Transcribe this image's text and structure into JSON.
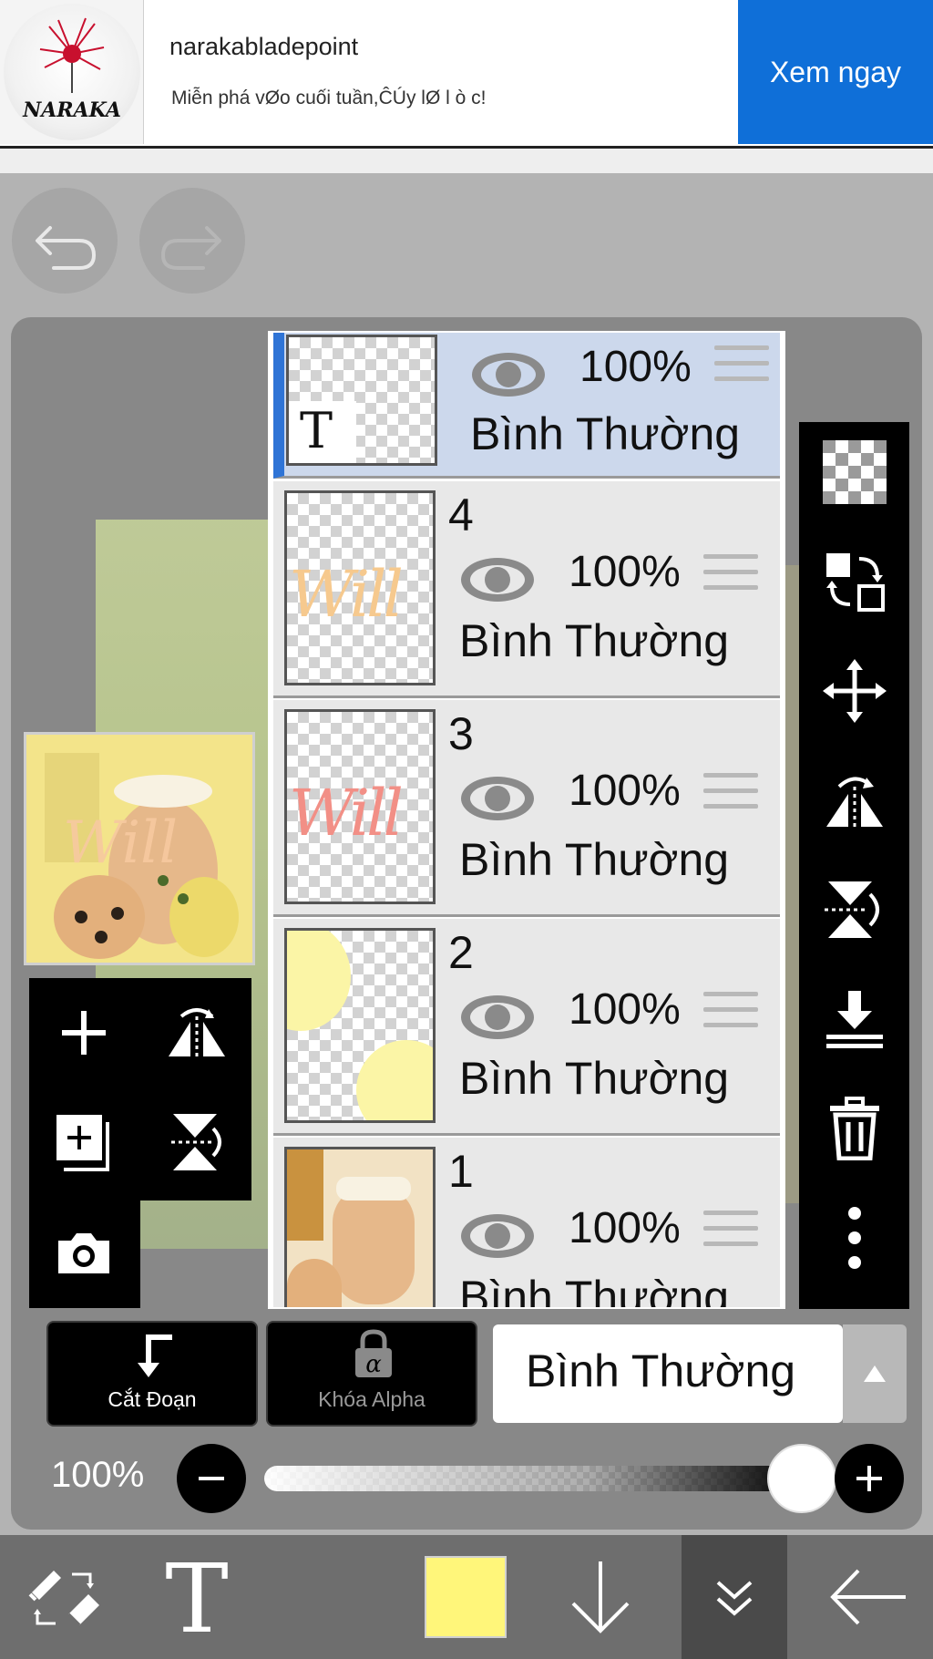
{
  "ad": {
    "brand_logo": "NARAKA",
    "title": "narakabladepoint",
    "description": "Miễn phá vØo cuối tuần,ĈÚy lØ l ò c!",
    "cta": "Xem ngay"
  },
  "toolbar_top": {
    "undo_icon": "undo-icon",
    "redo_icon": "redo-icon"
  },
  "layers": [
    {
      "number": "",
      "type": "text",
      "thumb_letter": "T",
      "opacity": "100%",
      "blend": "Bình Thường",
      "selected": true
    },
    {
      "number": "4",
      "opacity": "100%",
      "blend": "Bình Thường",
      "selected": false
    },
    {
      "number": "3",
      "opacity": "100%",
      "blend": "Bình Thường",
      "selected": false
    },
    {
      "number": "2",
      "opacity": "100%",
      "blend": "Bình Thường",
      "selected": false
    },
    {
      "number": "1",
      "opacity": "100%",
      "blend": "Bình Thường",
      "selected": false
    }
  ],
  "controls": {
    "clip_label": "Cắt Đoạn",
    "alpha_lock_label": "Khóa Alpha",
    "alpha_symbol": "α",
    "blend_mode": "Bình Thường",
    "opacity_label": "100%",
    "opacity_value": 1.0
  },
  "bottom_nav": {
    "current_color": "#fff67a"
  },
  "colors": {
    "accent": "#2f74d6",
    "ad_button": "#0f6fd8",
    "selected_row": "#ccd8ec"
  }
}
